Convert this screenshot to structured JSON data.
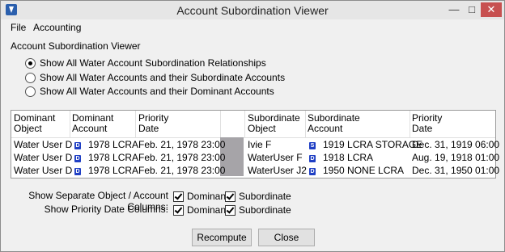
{
  "window": {
    "title": "Account Subordination Viewer"
  },
  "menu": {
    "items": [
      "File",
      "Accounting"
    ]
  },
  "section_label": "Account Subordination Viewer",
  "radio_options": [
    {
      "label": "Show All Water Account Subordination Relationships",
      "selected": true
    },
    {
      "label": "Show All Water Accounts and their Subordinate Accounts",
      "selected": false
    },
    {
      "label": "Show All Water Accounts and their Dominant Accounts",
      "selected": false
    }
  ],
  "table": {
    "headers": {
      "dom_object": [
        "Dominant",
        "Object"
      ],
      "dom_account": [
        "Dominant",
        "Account"
      ],
      "dom_priority": [
        "Priority",
        "Date"
      ],
      "sub_object": [
        "Subordinate",
        "Object"
      ],
      "sub_account": [
        "Subordinate",
        "Account"
      ],
      "sub_priority": [
        "Priority",
        "Date"
      ]
    },
    "rows": [
      {
        "dom_object": "Water User D",
        "dom_badge": "D",
        "dom_account": "1978 LCRA",
        "dom_priority": "Feb. 21, 1978  23:00",
        "sub_object": "Ivie F",
        "sub_badge": "S",
        "sub_account": "1919 LCRA STORAGE",
        "sub_priority": "Dec. 31, 1919  06:00"
      },
      {
        "dom_object": "Water User D",
        "dom_badge": "D",
        "dom_account": "1978 LCRA",
        "dom_priority": "Feb. 21, 1978  23:00",
        "sub_object": "WaterUser F",
        "sub_badge": "D",
        "sub_account": "1918 LCRA",
        "sub_priority": "Aug. 19, 1918  01:00"
      },
      {
        "dom_object": "Water User D",
        "dom_badge": "D",
        "dom_account": "1978 LCRA",
        "dom_priority": "Feb. 21, 1978  23:00",
        "sub_object": "WaterUser J2",
        "sub_badge": "D",
        "sub_account": "1950 NONE LCRA",
        "sub_priority": "Dec. 31, 1950  01:00"
      }
    ]
  },
  "options": {
    "columns_label": "Show Separate Object / Account Columns:",
    "priority_label": "Show Priority Date Columns:",
    "dominant": "Dominant",
    "subordinate": "Subordinate"
  },
  "buttons": {
    "recompute": "Recompute",
    "close": "Close"
  }
}
